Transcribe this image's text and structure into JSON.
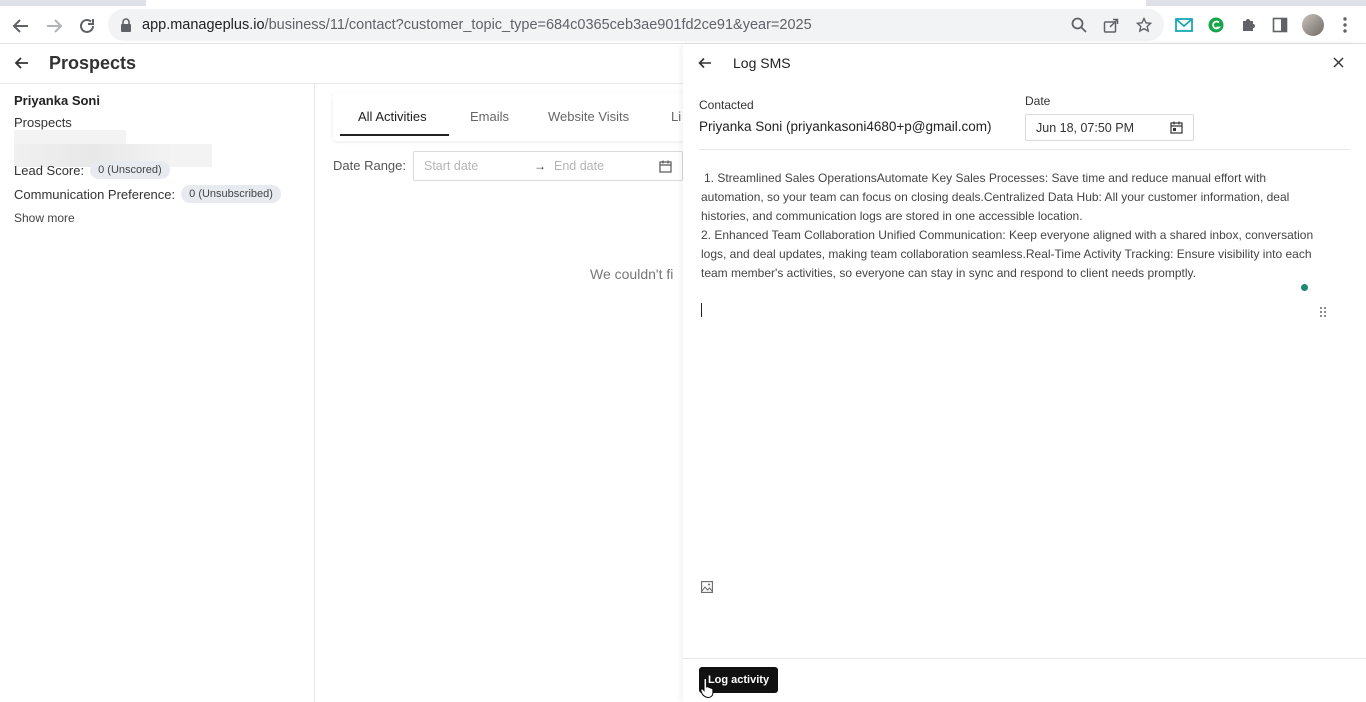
{
  "browser": {
    "url_host": "app.manageplus.io",
    "url_path": "/business/11/contact?customer_topic_type=684c0365ceb3ae901fd2ce91&year=2025"
  },
  "page": {
    "title": "Prospects"
  },
  "contact": {
    "name": "Priyanka Soni",
    "stage": "Prospects",
    "lead_score_label": "Lead Score:",
    "lead_score_value": "0 (Unscored)",
    "comm_pref_label": "Communication Preference:",
    "comm_pref_value": "0 (Unsubscribed)",
    "show_more": "Show more"
  },
  "activities": {
    "tabs": [
      "All Activities",
      "Emails",
      "Website Visits",
      "Li"
    ],
    "active_tab": "All Activities",
    "date_range_label": "Date Range:",
    "start_placeholder": "Start date",
    "end_placeholder": "End date",
    "arrow": "→",
    "empty_message": "We couldn't fi"
  },
  "drawer": {
    "title": "Log SMS",
    "contacted_label": "Contacted",
    "contacted_value": "Priyanka Soni (priyankasoni4680+p@gmail.com)",
    "date_label": "Date",
    "date_value": "Jun 18, 07:50 PM",
    "body": [
      "1. Streamlined Sales OperationsAutomate Key Sales Processes: Save time and reduce manual effort with automation, so your team can focus on closing deals.Centralized Data Hub: All your customer information, deal histories, and communication logs are stored in one accessible location.",
      "2. Enhanced Team Collaboration Unified Communication: Keep everyone aligned with a shared inbox, conversation logs, and deal updates, making team collaboration seamless.Real-Time Activity Tracking: Ensure visibility into each team member's activities, so everyone can stay in sync and respond to client needs promptly."
    ],
    "submit_label": "Log activity"
  },
  "colors": {
    "accent_dot": "#1b8a72",
    "button_bg": "#111111",
    "pill_bg": "#e7ebf0"
  },
  "icons": {
    "browser": [
      "back-arrow-icon",
      "forward-arrow-icon",
      "reload-icon",
      "lock-icon",
      "zoom-icon",
      "share-icon",
      "star-icon",
      "mail-extension-icon",
      "grammarly-icon",
      "puzzle-icon",
      "sidepanel-icon",
      "avatar",
      "kebab-menu-icon"
    ],
    "drawer": [
      "back-arrow-icon",
      "close-icon",
      "calendar-icon",
      "drag-handle-icon",
      "image-icon"
    ]
  }
}
